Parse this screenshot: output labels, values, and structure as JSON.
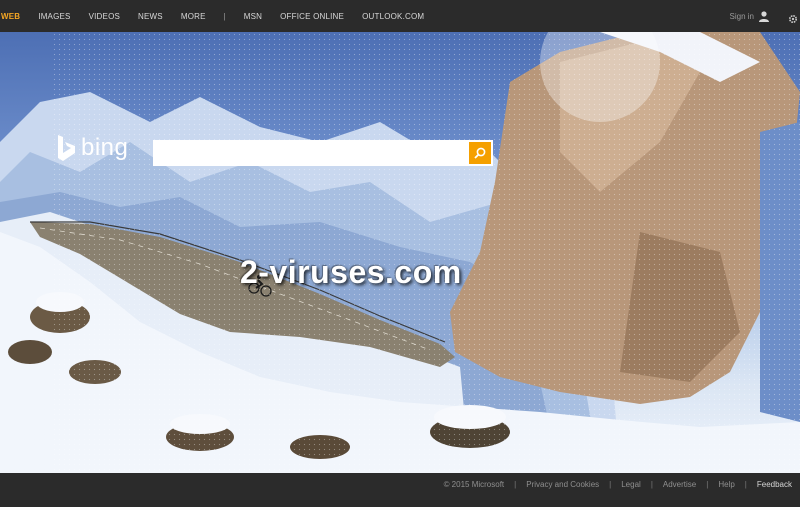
{
  "nav": {
    "items": [
      "WEB",
      "IMAGES",
      "VIDEOS",
      "NEWS",
      "MORE"
    ],
    "separator": "|",
    "extra": [
      "MSN",
      "OFFICE ONLINE",
      "OUTLOOK.COM"
    ]
  },
  "account": {
    "signin_label": "Sign in"
  },
  "brand": {
    "name": "bing"
  },
  "search": {
    "value": "",
    "placeholder": ""
  },
  "watermark": "2-viruses.com",
  "footer": {
    "copyright": "© 2015 Microsoft",
    "links": [
      "Privacy and Cookies",
      "Legal",
      "Advertise",
      "Help",
      "Feedback"
    ],
    "separator": "|"
  },
  "colors": {
    "accent": "#f5a000",
    "active_nav": "#f5a623",
    "bar": "#2b2b2b"
  },
  "icons": [
    "user-icon",
    "gear-icon",
    "search-icon",
    "fullscreen-icon",
    "previous-icon",
    "next-icon",
    "info-icon",
    "bing-logo-icon"
  ]
}
